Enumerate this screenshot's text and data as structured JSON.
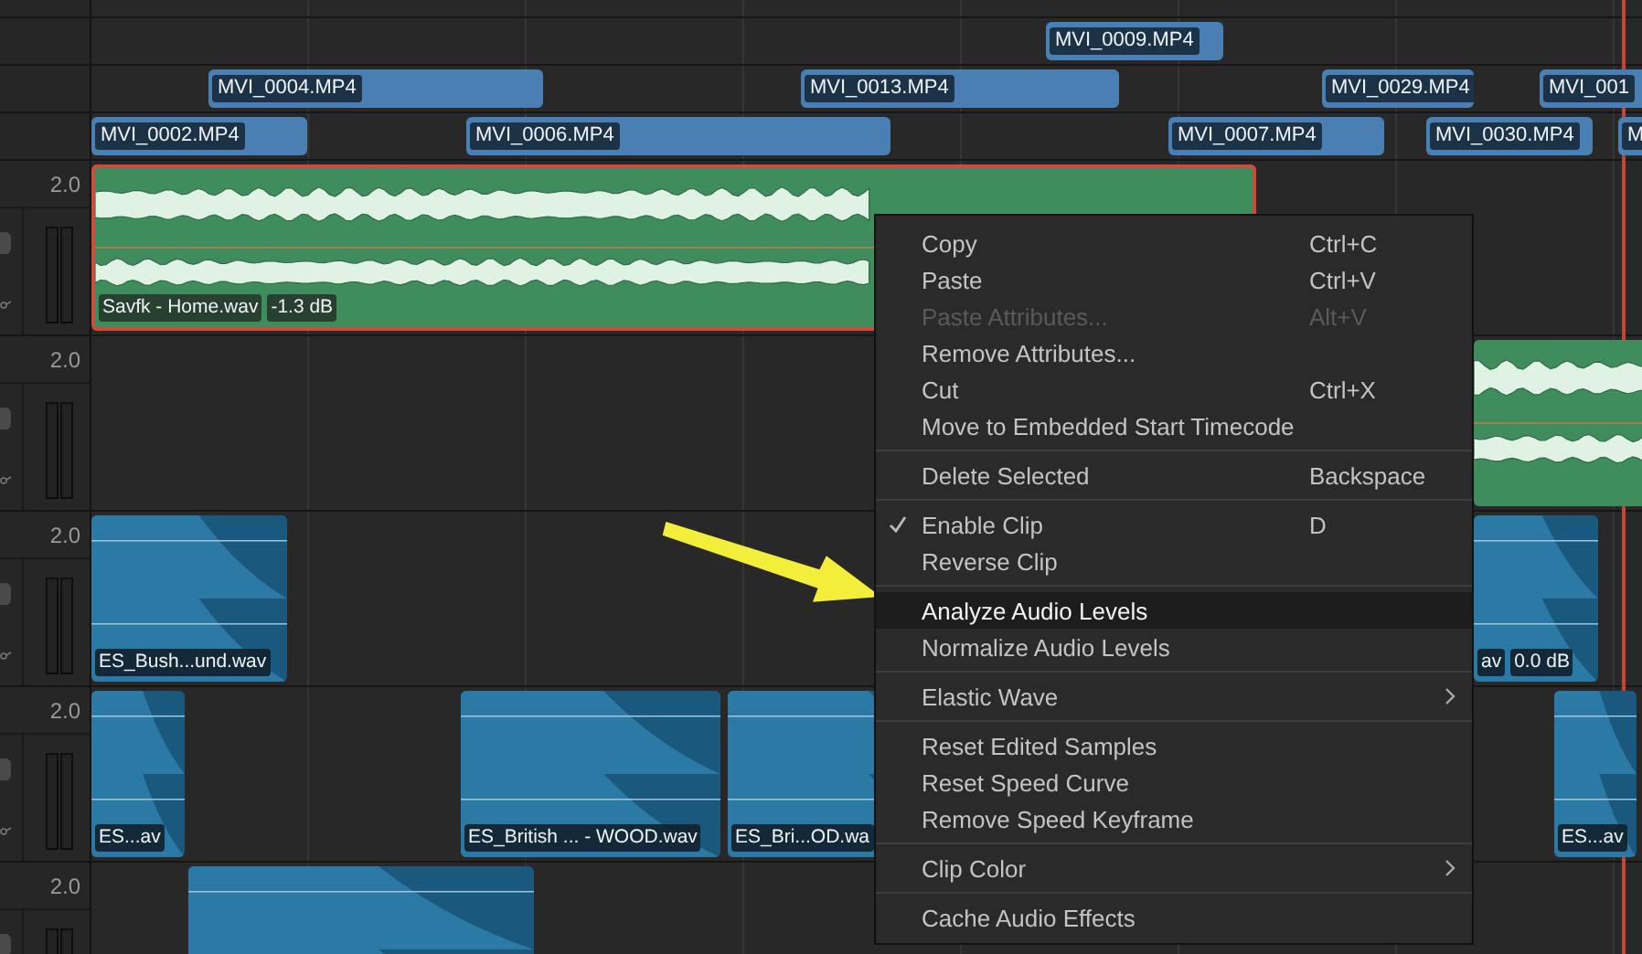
{
  "video_tracks": [
    {
      "clips": [
        {
          "label": "MVI_0009.MP4"
        }
      ]
    },
    {
      "clips": [
        {
          "label": "MVI_0004.MP4"
        },
        {
          "label": "MVI_0013.MP4"
        },
        {
          "label": "MVI_0029.MP4"
        },
        {
          "label": "MVI_001"
        }
      ]
    },
    {
      "clips": [
        {
          "label": "MVI_0002.MP4"
        },
        {
          "label": "MVI_0006.MP4"
        },
        {
          "label": "MVI_0007.MP4"
        },
        {
          "label": "MVI_0030.MP4"
        },
        {
          "label": "M"
        }
      ]
    }
  ],
  "audio_tracks": [
    {
      "gain": "2.0",
      "clips": [
        {
          "kind": "music",
          "label": "Savfk - Home.wav",
          "reading": "-1.3 dB",
          "selected": true
        }
      ]
    },
    {
      "gain": "2.0",
      "clips": [
        {
          "kind": "music",
          "selected": false
        }
      ]
    },
    {
      "gain": "2.0",
      "clips": [
        {
          "kind": "effect",
          "label": "ES_Bush...und.wav",
          "selected": false
        },
        {
          "kind": "effect",
          "label": "av",
          "reading": "0.0 dB",
          "selected": false
        }
      ]
    },
    {
      "gain": "2.0",
      "clips": [
        {
          "kind": "effect",
          "label": "ES...av",
          "selected": false
        },
        {
          "kind": "effect",
          "label": "ES_British ... - WOOD.wav",
          "selected": false
        },
        {
          "kind": "effect",
          "label": "ES_Bri...OD.wa",
          "selected": false
        },
        {
          "kind": "effect",
          "label": "ES...av",
          "selected": false
        }
      ]
    },
    {
      "gain": "2.0",
      "clips": [
        {
          "kind": "effect",
          "selected": false
        }
      ]
    }
  ],
  "menu": {
    "items": [
      {
        "kind": "item",
        "label": "Copy",
        "shortcut": "Ctrl+C",
        "disabled": false,
        "checked": false,
        "selected": false,
        "submenu": false
      },
      {
        "kind": "item",
        "label": "Paste",
        "shortcut": "Ctrl+V",
        "disabled": false,
        "checked": false,
        "selected": false,
        "submenu": false
      },
      {
        "kind": "item",
        "label": "Paste Attributes...",
        "shortcut": "Alt+V",
        "disabled": true,
        "checked": false,
        "selected": false,
        "submenu": false
      },
      {
        "kind": "item",
        "label": "Remove Attributes...",
        "disabled": false,
        "checked": false,
        "selected": false,
        "submenu": false
      },
      {
        "kind": "item",
        "label": "Cut",
        "shortcut": "Ctrl+X",
        "disabled": false,
        "checked": false,
        "selected": false,
        "submenu": false
      },
      {
        "kind": "item",
        "label": "Move to Embedded Start Timecode",
        "disabled": false,
        "checked": false,
        "selected": false,
        "submenu": false
      },
      {
        "kind": "separator"
      },
      {
        "kind": "item",
        "label": "Delete Selected",
        "shortcut": "Backspace",
        "disabled": false,
        "checked": false,
        "selected": false,
        "submenu": false
      },
      {
        "kind": "separator"
      },
      {
        "kind": "item",
        "label": "Enable Clip",
        "shortcut": "D",
        "disabled": false,
        "checked": true,
        "selected": false,
        "submenu": false
      },
      {
        "kind": "item",
        "label": "Reverse Clip",
        "disabled": false,
        "checked": false,
        "selected": false,
        "submenu": false
      },
      {
        "kind": "separator"
      },
      {
        "kind": "item",
        "label": "Analyze Audio Levels",
        "disabled": false,
        "checked": false,
        "selected": true,
        "submenu": false
      },
      {
        "kind": "item",
        "label": "Normalize Audio Levels",
        "disabled": false,
        "checked": false,
        "selected": false,
        "submenu": false
      },
      {
        "kind": "separator"
      },
      {
        "kind": "item",
        "label": "Elastic Wave",
        "disabled": false,
        "checked": false,
        "selected": false,
        "submenu": true
      },
      {
        "kind": "separator"
      },
      {
        "kind": "item",
        "label": "Reset Edited Samples",
        "disabled": false,
        "checked": false,
        "selected": false,
        "submenu": false
      },
      {
        "kind": "item",
        "label": "Reset Speed Curve",
        "disabled": false,
        "checked": false,
        "selected": false,
        "submenu": false
      },
      {
        "kind": "item",
        "label": "Remove Speed Keyframe",
        "disabled": false,
        "checked": false,
        "selected": false,
        "submenu": false
      },
      {
        "kind": "separator"
      },
      {
        "kind": "item",
        "label": "Clip Color",
        "disabled": false,
        "checked": false,
        "selected": false,
        "submenu": true
      },
      {
        "kind": "separator"
      },
      {
        "kind": "item",
        "label": "Cache Audio Effects",
        "disabled": false,
        "checked": false,
        "selected": false,
        "submenu": false
      }
    ]
  }
}
